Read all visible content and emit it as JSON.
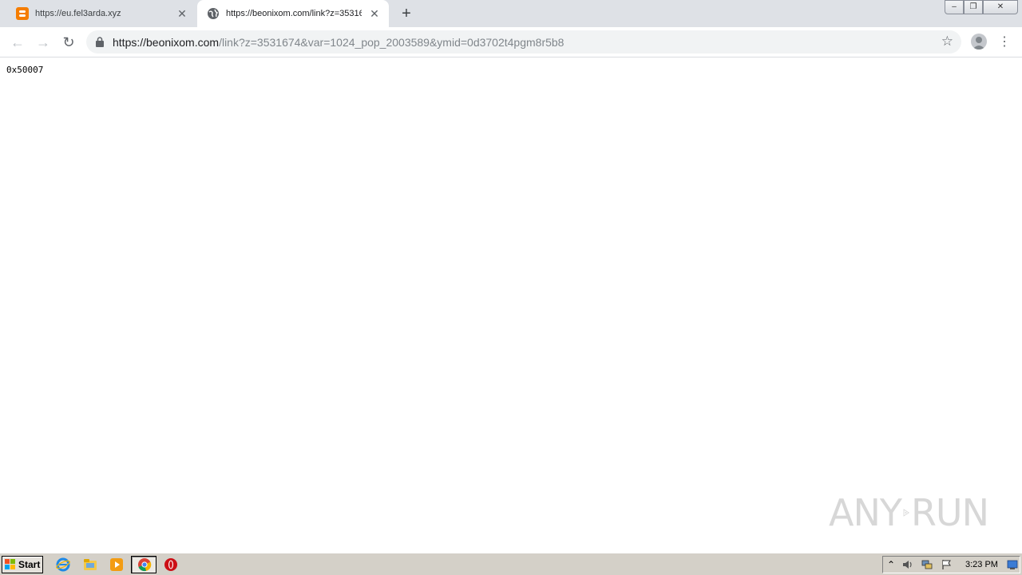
{
  "browser": {
    "tabs": [
      {
        "title": "https://eu.fel3arda.xyz",
        "favicon": "blogger-icon",
        "active": false
      },
      {
        "title": "https://beonixom.com/link?z=35316",
        "favicon": "globe-icon",
        "active": true
      }
    ],
    "new_tab_glyph": "+",
    "close_glyph": "✕",
    "window_controls": {
      "minimize": "–",
      "maximize": "❐",
      "close": "✕"
    },
    "toolbar": {
      "back_glyph": "←",
      "forward_glyph": "→",
      "reload_glyph": "↻",
      "url_host": "https://beonixom.com",
      "url_path": "/link?z=3531674&var=1024_pop_2003589&ymid=0d3702t4pgm8r5b8",
      "star_glyph": "☆",
      "menu_glyph": "⋮"
    }
  },
  "page": {
    "body_text": "0x50007",
    "watermark_left": "ANY",
    "watermark_right": "RUN"
  },
  "taskbar": {
    "start_label": "Start",
    "pinned": [
      "internet-explorer-icon",
      "file-explorer-icon",
      "media-player-icon",
      "chrome-icon",
      "opera-icon"
    ],
    "tray_chevron": "⌃",
    "clock": "3:23 PM"
  },
  "colors": {
    "tabstrip": "#dee1e6",
    "omnibox": "#f1f3f4",
    "taskbar": "#d4d0c8",
    "blogger": "#f57d00"
  }
}
